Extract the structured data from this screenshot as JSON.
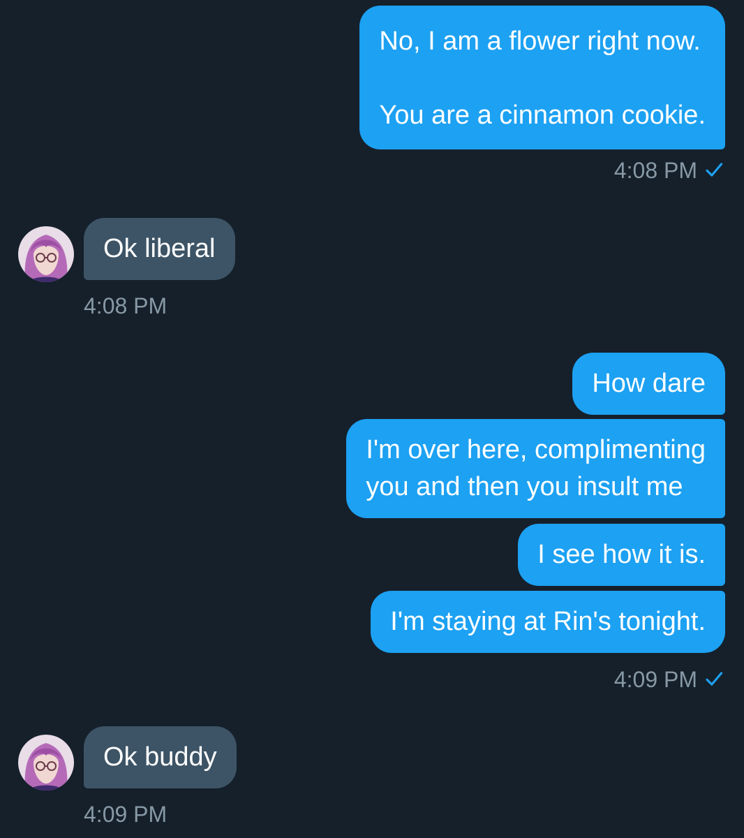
{
  "conversation": {
    "messages": [
      {
        "text": "No, I am a flower right now.\n\nYou are a cinnamon cookie."
      },
      {
        "text": "Ok liberal"
      },
      {
        "text": "How dare"
      },
      {
        "text": "I'm over here, complimenting\nyou and then you insult me"
      },
      {
        "text": "I see how it is."
      },
      {
        "text": "I'm staying at Rin's tonight."
      },
      {
        "text": "Ok buddy"
      }
    ],
    "timestamps": {
      "sent_1": "4:08 PM",
      "recv_1": "4:08 PM",
      "sent_2": "4:09 PM",
      "recv_2": "4:09 PM"
    },
    "icons": {
      "read_receipt": "checkmark-icon",
      "avatar": "avatar"
    }
  },
  "colors": {
    "background": "#15202b",
    "sent_bubble": "#1da1f2",
    "received_bubble": "#3d5466",
    "timestamp": "#8899a6"
  }
}
